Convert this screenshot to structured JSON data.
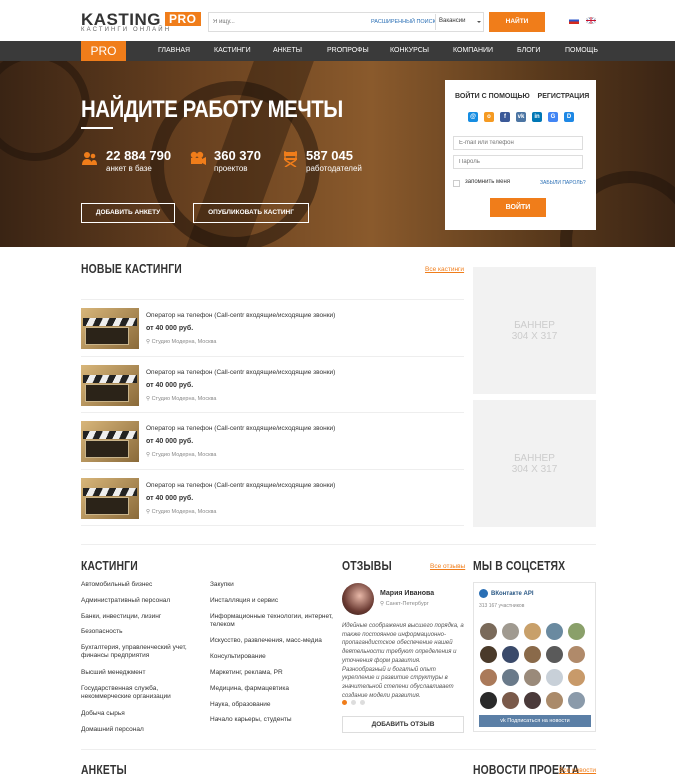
{
  "header": {
    "logo_text": "KASTING",
    "logo_badge": "PRO",
    "logo_sub": "КАСТИНГИ ОНЛАЙН",
    "search_placeholder": "Я ищу...",
    "advanced_search": "РАСШИРЕННЫЙ ПОИСК",
    "search_scope": "Вакансии",
    "search_button": "НАЙТИ",
    "languages": [
      "ru",
      "en"
    ]
  },
  "nav": {
    "pro": "PRO",
    "items": [
      "ГЛАВНАЯ",
      "КАСТИНГИ",
      "АНКЕТЫ",
      "PROПРОФЫ",
      "КОНКУРСЫ",
      "КОМПАНИИ",
      "БЛОГИ",
      "ПОМОЩЬ"
    ]
  },
  "hero": {
    "title": "НАЙДИТЕ РАБОТУ МЕЧТЫ",
    "stats": [
      {
        "number": "22 884 790",
        "label": "анкет в базе",
        "icon": "users-icon"
      },
      {
        "number": "360 370",
        "label": "проектов",
        "icon": "film-camera-icon"
      },
      {
        "number": "587 045",
        "label": "работодателей",
        "icon": "director-chair-icon"
      }
    ],
    "add_profile_button": "ДОБАВИТЬ АНКЕТУ",
    "publish_casting_button": "ОПУБЛИКОВАТЬ КАСТИНГ"
  },
  "login": {
    "login_with": "ВОЙТИ С ПОМОЩЬЮ",
    "register": "РЕГИСТРАЦИЯ",
    "social": [
      "mail",
      "odnoklassniki",
      "facebook",
      "vkontakte",
      "linkedin",
      "google",
      "d"
    ],
    "email_placeholder": "E-mail или телефон",
    "password_placeholder": "Пароль",
    "remember": "запомнить меня",
    "forgot": "ЗАБЫЛИ ПАРОЛЬ?",
    "submit": "ВОЙТИ"
  },
  "castings": {
    "title": "НОВЫЕ КАСТИНГИ",
    "all_link": "Все кастинги",
    "items": [
      {
        "title": "Оператор на телефон (Call-centr входящие/исходящие звонки)",
        "price": "от 40 000 руб.",
        "location": "Студио Модерна, Москва"
      },
      {
        "title": "Оператор на телефон (Call-centr входящие/исходящие звонки)",
        "price": "от 40 000 руб.",
        "location": "Студио Модерна, Москва"
      },
      {
        "title": "Оператор на телефон (Call-centr входящие/исходящие звонки)",
        "price": "от 40 000 руб.",
        "location": "Студио Модерна, Москва"
      },
      {
        "title": "Оператор на телефон (Call-centr входящие/исходящие звонки)",
        "price": "от 40 000 руб.",
        "location": "Студио Модерна, Москва"
      }
    ]
  },
  "banners": [
    {
      "line1": "БАННЕР",
      "line2": "304 Х 317"
    },
    {
      "line1": "БАННЕР",
      "line2": "304 Х 317"
    }
  ],
  "categories": {
    "title": "КАСТИНГИ",
    "col1": [
      "Автомобильный бизнес",
      "Административный персонал",
      "Банки, инвестиции, лизинг",
      "Безопасность",
      "Бухгалтерия, управленческий учет, финансы предприятия",
      "Высший менеджмент",
      "Государственная служба, некоммерческие организации",
      "Добыча сырья",
      "Домашний персонал"
    ],
    "col2": [
      "Закупки",
      "Инсталляция и сервис",
      "Информационные технологии, интернет, телеком",
      "Искусство, развлечения, масс-медиа",
      "Консультирование",
      "Маркетинг, реклама, PR",
      "Медицина, фармацевтика",
      "Наука, образование",
      "Начало карьеры, студенты"
    ]
  },
  "reviews": {
    "title": "ОТЗЫВЫ",
    "all_link": "Все отзывы",
    "name": "Мария Иванова",
    "city": "Санкт-Петербург",
    "text": "Идейные соображения высшего порядка, а также постоянное информационно-пропагандистское обеспечение нашей деятельности требуют определения и уточнения форм развития. Разнообразный и богатый опыт укрепление и развитие структуры в значительной степени обуславливает создание модели развития.",
    "add_button": "ДОБАВИТЬ ОТЗЫВ"
  },
  "social_block": {
    "title": "МЫ В СОЦСЕТЯХ",
    "group_name": "ВКонтакте API",
    "members": "313 167 участников",
    "subscribe": "Подписаться на новости"
  },
  "bottom": {
    "profiles_title": "АНКЕТЫ",
    "news_title": "НОВОСТИ ПРОЕКТА",
    "news_link": "Все новости"
  },
  "colors": {
    "accent": "#f07d1a",
    "nav_bg": "#3a3a3a"
  }
}
